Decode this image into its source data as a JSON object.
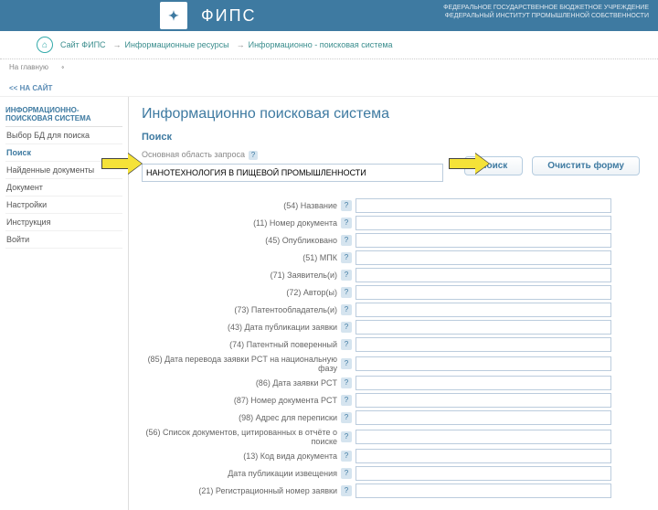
{
  "header": {
    "brand": "ФИПС",
    "subtitle_line1": "ФЕДЕРАЛЬНОЕ ГОСУДАРСТВЕННОЕ БЮДЖЕТНОЕ УЧРЕЖДЕНИЕ",
    "subtitle_line2": "ФЕДЕРАЛЬНЫЙ ИНСТИТУТ ПРОМЫШЛЕННОЙ СОБСТВЕННОСТИ"
  },
  "breadcrumbs": [
    "Сайт ФИПС",
    "Информационные ресурсы",
    "Информационно - поисковая система"
  ],
  "top_buttons": {
    "back": "На главную",
    "to_site": "<< НА САЙТ"
  },
  "sidebar": {
    "section": "ИНФОРМАЦИОННО-ПОИСКОВАЯ СИСТЕМА",
    "items": [
      "Выбор БД для поиска",
      "Поиск",
      "Найденные документы",
      "Документ",
      "Настройки",
      "Инструкция",
      "Войти"
    ]
  },
  "page": {
    "title": "Информационно поисковая система",
    "search_heading": "Поиск",
    "main_area_label": "Основная область запроса",
    "main_input_value": "НАНОТЕХНОЛОГИЯ В ПИЩЕВОЙ ПРОМЫШЛЕННОСТИ",
    "btn_search": "Поиск",
    "btn_clear": "Очистить форму"
  },
  "fields": [
    "(54) Название",
    "(11) Номер документа",
    "(45) Опубликовано",
    "(51) МПК",
    "(71) Заявитель(и)",
    "(72) Автор(ы)",
    "(73) Патентообладатель(и)",
    "(43) Дата публикации заявки",
    "(74) Патентный поверенный",
    "(85) Дата перевода заявки PCT на национальную фазу",
    "(86) Дата заявки PCT",
    "(87) Номер документа PCT",
    "(98) Адрес для переписки",
    "(56) Список документов, цитированных в отчёте о поиске",
    "(13) Код вида документа",
    "Дата публикации извещения",
    "(21) Регистрационный номер заявки"
  ]
}
